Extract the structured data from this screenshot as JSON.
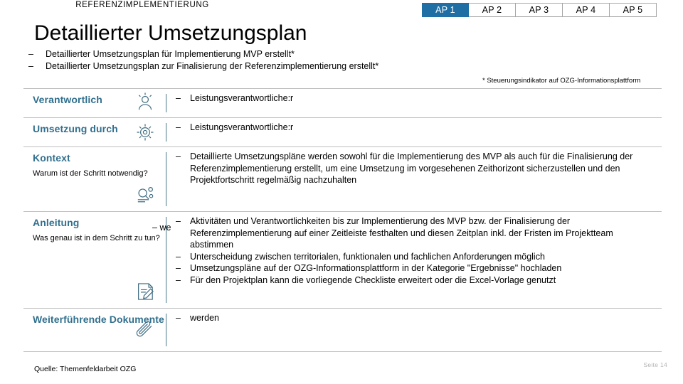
{
  "tabs": [
    {
      "label": "AP 1",
      "active": true
    },
    {
      "label": "AP 2",
      "active": false
    },
    {
      "label": "AP 3",
      "active": false
    },
    {
      "label": "AP 4",
      "active": false
    },
    {
      "label": "AP 5",
      "active": false
    }
  ],
  "header": {
    "eyebrow": "REFERENZIMPLEMENTIERUNG",
    "title": "Detaillierter Umsetzungsplan",
    "bullets": [
      "Detaillierter Umsetzungsplan für Implementierung MVP erstellt*",
      "Detaillierter Umsetzungsplan zur Finalisierung der Referenzimplementierung erstellt*"
    ],
    "dash": "–"
  },
  "footnote": "* Steuerungsindikator auf OZG-Informationsplattform",
  "rows": [
    {
      "title": "Verantwortlich",
      "subtitle": "",
      "icon": "person-icon",
      "items": [
        "Leistungsverantwortliche:r"
      ]
    },
    {
      "title": "Umsetzung durch",
      "subtitle": "",
      "icon": "team-gear-icon",
      "items": [
        "Leistungsverantwortliche:r"
      ]
    },
    {
      "title": "Kontext",
      "subtitle": "Warum ist der Schritt notwendig?",
      "icon": "magnifier-document-icon",
      "items": [
        "Detaillierte Umsetzungspläne werden sowohl für die Implementierung des MVP als auch für die Finalisierung der Referenzimplementierung erstellt, um eine Umsetzung im vorgesehenen Zeithorizont sicherzustellen und den Projektfortschritt regelmäßig nachzuhalten"
      ]
    },
    {
      "title": "Anleitung",
      "subtitle": "Was genau ist in dem Schritt zu tun?",
      "icon": "edit-document-icon",
      "items": [
        "Aktivitäten und Verantwortlichkeiten bis zur Implementierung des MVP bzw. der Finalisierung der Referenzimplementierung auf einer Zeitleiste festhalten und diesen Zeitplan inkl. der Fristen im Projektteam abstimmen",
        "Unterscheidung zwischen territorialen, funktionalen und fachlichen Anforderungen möglich",
        "Umsetzungspläne auf der OZG-Informationsplattform in der Kategorie \"Ergebnisse\" hochladen",
        "Für den Projektplan kann die vorliegende Checkliste erweitert oder die Excel-Vorlage genutzt"
      ]
    },
    {
      "title": "Weiterführende Dokumente",
      "subtitle": "",
      "icon": "paperclip-icon",
      "items": [
        "werden"
      ]
    }
  ],
  "overlap": {
    "dash": "–",
    "text": "we"
  },
  "footer": {
    "source": "Quelle: Themenfeldarbeit OZG",
    "page": "Seite 14"
  },
  "colors": {
    "accent": "#31708e",
    "tab_active_bg": "#1f6fa4",
    "rule": "#bfbfbf",
    "icon": "#3d6b80"
  }
}
